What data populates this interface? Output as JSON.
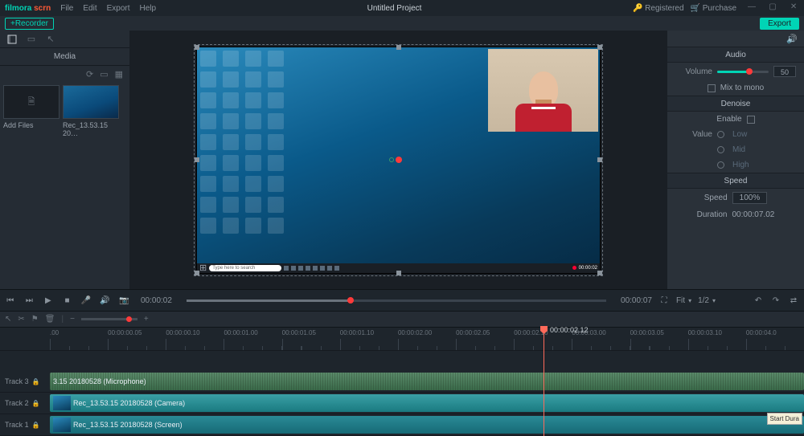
{
  "app": {
    "brand_prefix": "filmora",
    "brand_suffix": "scrn"
  },
  "menu": {
    "file": "File",
    "edit": "Edit",
    "export": "Export",
    "help": "Help"
  },
  "project": {
    "title": "Untitled Project"
  },
  "header": {
    "registered": "Registered",
    "purchase": "Purchase",
    "export": "Export",
    "recorder": "+Recorder"
  },
  "leftpanel": {
    "title": "Media"
  },
  "media": {
    "add_files": "Add Files",
    "clip_name": "Rec_13.53.15 20…"
  },
  "preview": {
    "search_placeholder": "Type here to search",
    "rec_time": "00:00:02"
  },
  "transport": {
    "current": "00:00:02",
    "total": "00:00:07",
    "fit": "Fit",
    "zoom": "1/2"
  },
  "timeline": {
    "playhead": "00:00:02.12",
    "ticks": [
      ".00",
      "00:00:00.05",
      "00:00:00.10",
      "00:00:01.00",
      "00:00:01.05",
      "00:00:01.10",
      "00:00:02.00",
      "00:00:02.05",
      "00:00:02.10",
      "00:00:03.00",
      "00:00:03.05",
      "00:00:03.10",
      "00:00:04.0"
    ]
  },
  "tracks": {
    "t3_label": "Track 3",
    "t2_label": "Track 2",
    "t1_label": "Track 1",
    "t3_clip": "3.15 20180528 (Microphone)",
    "t2_clip": "Rec_13.53.15 20180528 (Camera)",
    "t1_clip": "Rec_13.53.15 20180528 (Screen)"
  },
  "audio": {
    "section": "Audio",
    "volume_label": "Volume",
    "volume_value": "50",
    "mix_to_mono": "Mix to mono",
    "denoise_section": "Denoise",
    "enable": "Enable",
    "value_label": "Value",
    "low": "Low",
    "mid": "Mid",
    "high": "High"
  },
  "speed": {
    "section": "Speed",
    "speed_label": "Speed",
    "speed_value": "100%",
    "duration_label": "Duration",
    "duration_value": "00:00:07.02"
  },
  "tooltip": {
    "text": "Start\nDura"
  }
}
